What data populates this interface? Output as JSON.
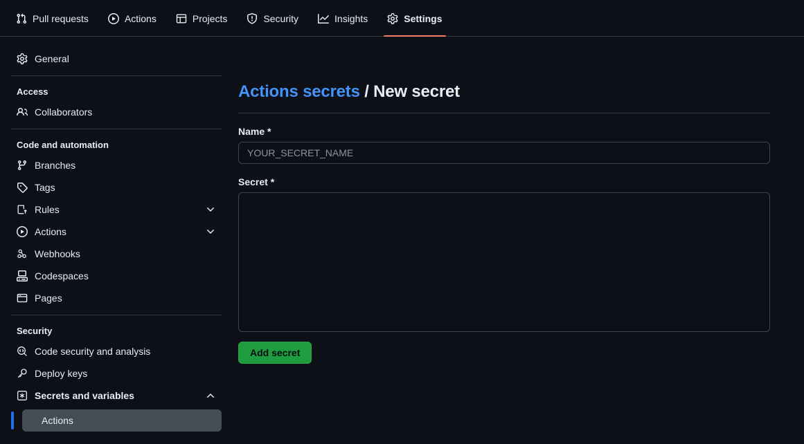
{
  "topnav": {
    "items": [
      {
        "label": "Pull requests",
        "icon": "git-pull-request-icon",
        "selected": false
      },
      {
        "label": "Actions",
        "icon": "play-circle-icon",
        "selected": false
      },
      {
        "label": "Projects",
        "icon": "table-grid-icon",
        "selected": false
      },
      {
        "label": "Security",
        "icon": "shield-alert-icon",
        "selected": false
      },
      {
        "label": "Insights",
        "icon": "graph-line-icon",
        "selected": false
      },
      {
        "label": "Settings",
        "icon": "gear-icon",
        "selected": true
      }
    ],
    "accent_color": "#f78166"
  },
  "sidebar": {
    "general": {
      "label": "General",
      "icon": "gear-icon"
    },
    "access_title": "Access",
    "collaborators": {
      "label": "Collaborators",
      "icon": "people-icon"
    },
    "code_title": "Code and automation",
    "code_items": [
      {
        "label": "Branches",
        "icon": "git-branch-icon",
        "chevron": ""
      },
      {
        "label": "Tags",
        "icon": "tag-icon",
        "chevron": ""
      },
      {
        "label": "Rules",
        "icon": "rules-book-icon",
        "chevron": "down"
      },
      {
        "label": "Actions",
        "icon": "play-circle-icon",
        "chevron": "down"
      },
      {
        "label": "Webhooks",
        "icon": "webhook-icon",
        "chevron": ""
      },
      {
        "label": "Codespaces",
        "icon": "codespaces-icon",
        "chevron": ""
      },
      {
        "label": "Pages",
        "icon": "browser-window-icon",
        "chevron": ""
      }
    ],
    "security_title": "Security",
    "security_items": [
      {
        "label": "Code security and analysis",
        "icon": "code-scan-icon",
        "chevron": ""
      },
      {
        "label": "Deploy keys",
        "icon": "key-icon",
        "chevron": ""
      },
      {
        "label": "Secrets and variables",
        "icon": "asterisk-square-icon",
        "chevron": "up"
      }
    ],
    "secrets_subitem": {
      "label": "Actions",
      "selected": true
    },
    "selected_bar_color": "#1f6feb",
    "selected_bg_color": "#444c56"
  },
  "main": {
    "breadcrumb_link": "Actions secrets",
    "breadcrumb_sep": " / ",
    "breadcrumb_current": "New secret",
    "name_label": "Name *",
    "name_value": "",
    "name_placeholder": "YOUR_SECRET_NAME",
    "secret_label": "Secret *",
    "secret_value": "",
    "secret_placeholder": "",
    "submit_label": "Add secret",
    "submit_color": "#1f9c3f",
    "link_color": "#4493f8"
  }
}
